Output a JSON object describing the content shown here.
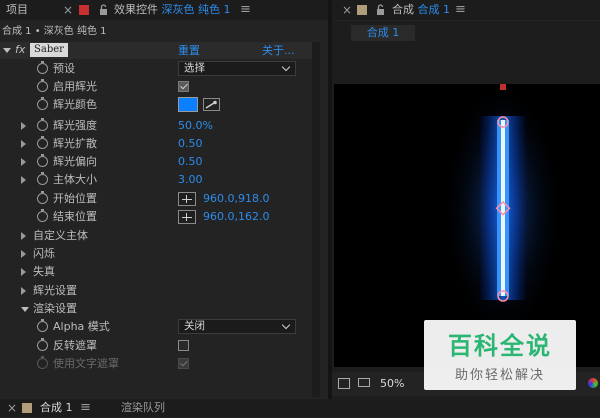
{
  "tabs": {
    "project": "项目",
    "effects_label": "效果控件",
    "effects_target": "深灰色 纯色 1",
    "comp_label": "合成",
    "comp_target": "合成 1"
  },
  "effects": {
    "path": "合成 1 • 深灰色 纯色 1",
    "fx": "fx",
    "effect_name": "Saber",
    "reset": "重置",
    "about": "关于..."
  },
  "params": [
    {
      "label": "预设",
      "value": "选择"
    },
    {
      "label": "启用辉光",
      "checked": true
    },
    {
      "label": "辉光颜色",
      "color": "#0a7fff"
    },
    {
      "label": "辉光强度",
      "value": "50.0%"
    },
    {
      "label": "辉光扩散",
      "value": "0.50"
    },
    {
      "label": "辉光偏向",
      "value": "0.50"
    },
    {
      "label": "主体大小",
      "value": "3.00"
    },
    {
      "label": "开始位置",
      "value": "960.0,918.0"
    },
    {
      "label": "结束位置",
      "value": "960.0,162.0"
    }
  ],
  "groups": [
    "自定义主体",
    "闪烁",
    "失真",
    "辉光设置",
    "渲染设置"
  ],
  "render": [
    {
      "label": "Alpha 模式",
      "value": "关闭"
    },
    {
      "label": "反转遮罩",
      "checked": false
    },
    {
      "label": "使用文字遮罩",
      "checked": true
    }
  ],
  "viewer": {
    "comp_tab": "合成 1",
    "zoom": "50%"
  },
  "bottom_tabs": {
    "comp": "合成 1",
    "render_queue": "渲染队列"
  },
  "watermark": {
    "title": "百科全说",
    "subtitle": "助你轻松解决"
  }
}
